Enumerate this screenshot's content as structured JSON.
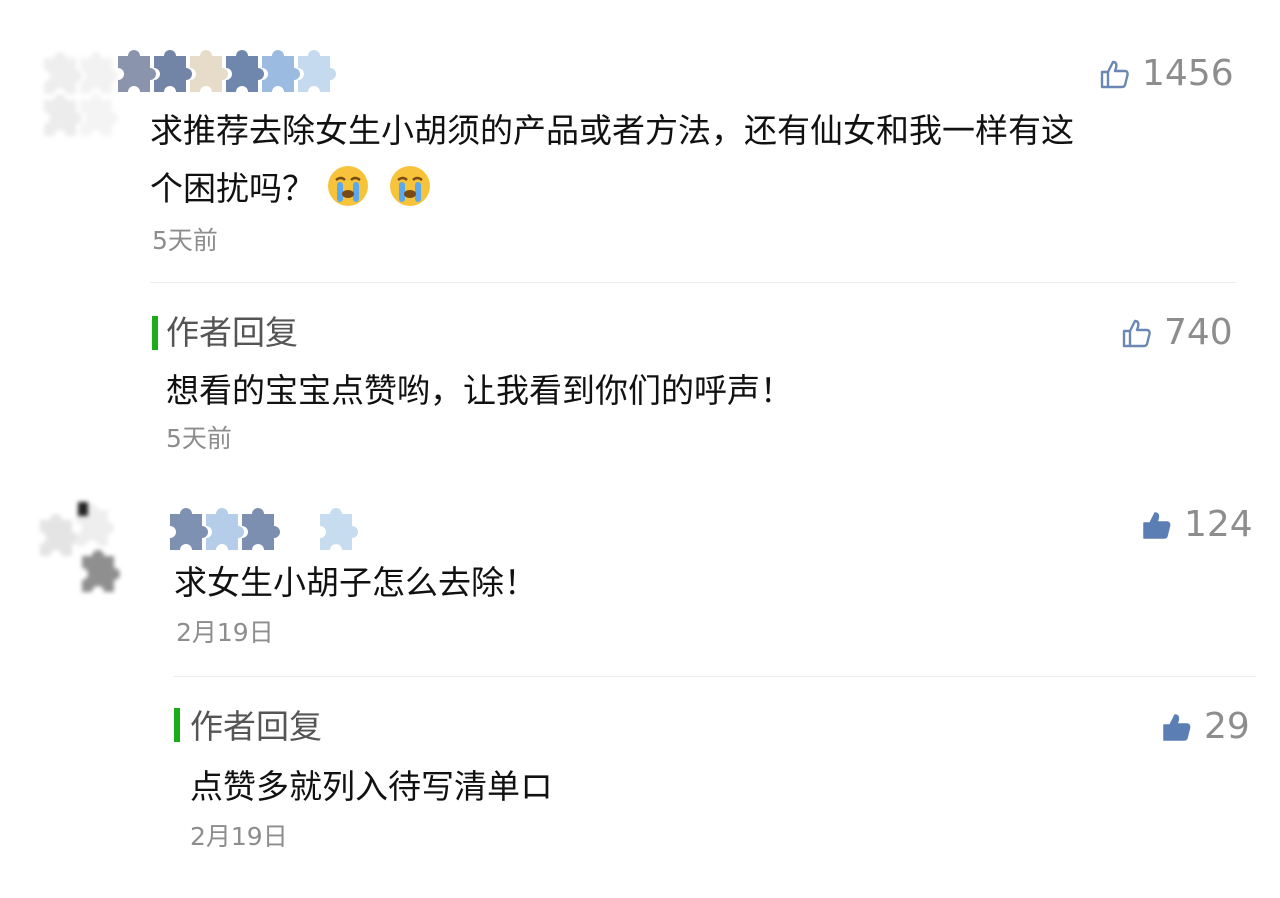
{
  "comments": [
    {
      "likes": "1456",
      "text_line1": "求推荐去除女生小胡须的产品或者方法，还有仙女和我一样有这",
      "text_line2": "个困扰吗？",
      "time": "5天前",
      "reply": {
        "label": "作者回复",
        "likes": "740",
        "text": "想看的宝宝点赞哟，让我看到你们的呼声！",
        "time": "5天前"
      }
    },
    {
      "likes": "124",
      "text": "求女生小胡子怎么去除！",
      "time": "2月19日",
      "reply": {
        "label": "作者回复",
        "likes": "29",
        "text": "点赞多就列入待写清单ロ",
        "time": "2月19日"
      }
    }
  ],
  "icons": {
    "thumb_outline": "thumbs-up-outline-icon",
    "thumb_filled": "thumbs-up-filled-icon",
    "emoji": "crying-face-emoji"
  },
  "colors": {
    "reply_bar": "#1aad19",
    "like_filled": "#5b7fb4",
    "meta_gray": "#8d8d8d"
  }
}
